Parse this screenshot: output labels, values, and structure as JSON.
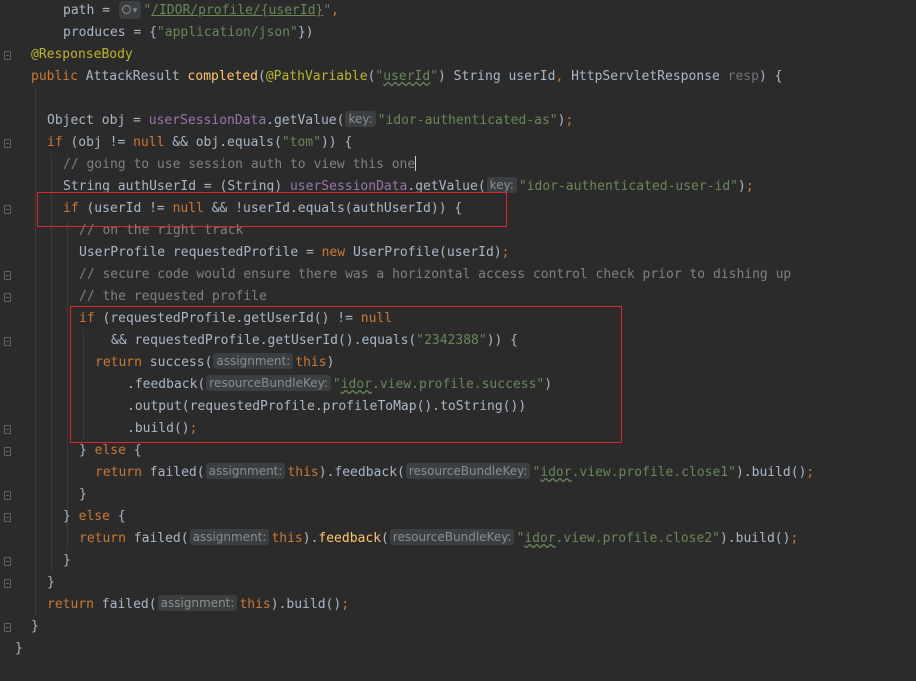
{
  "editor": {
    "lines": [
      {
        "indent": 63,
        "tokens": [
          {
            "c": "plain",
            "t": "path = "
          },
          {
            "c": "hint-globe",
            "t": ""
          },
          {
            "c": "str",
            "t": "\""
          },
          {
            "c": "str ul",
            "t": "/IDOR/profile/{userId}"
          },
          {
            "c": "str",
            "t": "\""
          },
          {
            "c": "kw",
            "t": ","
          }
        ]
      },
      {
        "indent": 63,
        "tokens": [
          {
            "c": "plain",
            "t": "produces = {"
          },
          {
            "c": "str",
            "t": "\"application/json\""
          },
          {
            "c": "plain",
            "t": "})"
          }
        ]
      },
      {
        "indent": 31,
        "tokens": [
          {
            "c": "ann",
            "t": "@ResponseBody"
          }
        ]
      },
      {
        "indent": 31,
        "tokens": [
          {
            "c": "kw",
            "t": "public "
          },
          {
            "c": "plain",
            "t": "AttackResult "
          },
          {
            "c": "fn",
            "t": "completed"
          },
          {
            "c": "plain",
            "t": "("
          },
          {
            "c": "ann",
            "t": "@PathVariable"
          },
          {
            "c": "plain",
            "t": "("
          },
          {
            "c": "str",
            "t": "\""
          },
          {
            "c": "str wavy",
            "t": "userId"
          },
          {
            "c": "str",
            "t": "\""
          },
          {
            "c": "plain",
            "t": ") String userId"
          },
          {
            "c": "kw",
            "t": ", "
          },
          {
            "c": "plain",
            "t": "HttpServletResponse "
          },
          {
            "c": "param",
            "t": "resp"
          },
          {
            "c": "plain",
            "t": ") {"
          }
        ]
      },
      {
        "indent": 47,
        "tokens": []
      },
      {
        "indent": 47,
        "tokens": [
          {
            "c": "plain",
            "t": "Object obj = "
          },
          {
            "c": "fld",
            "t": "userSessionData"
          },
          {
            "c": "plain",
            "t": ".getValue("
          },
          {
            "c": "hint",
            "t": "key:"
          },
          {
            "c": "str",
            "t": "\"idor-authenticated-as\""
          },
          {
            "c": "plain",
            "t": ")"
          },
          {
            "c": "kw",
            "t": ";"
          }
        ]
      },
      {
        "indent": 47,
        "tokens": [
          {
            "c": "kw",
            "t": "if "
          },
          {
            "c": "plain",
            "t": "(obj != "
          },
          {
            "c": "kw",
            "t": "null "
          },
          {
            "c": "plain",
            "t": "&& obj.equals("
          },
          {
            "c": "str",
            "t": "\"tom\""
          },
          {
            "c": "plain",
            "t": ")) {"
          }
        ]
      },
      {
        "indent": 63,
        "tokens": [
          {
            "c": "cmt",
            "t": "// going to use session auth to view this one"
          },
          {
            "c": "caret",
            "t": ""
          }
        ]
      },
      {
        "indent": 63,
        "tokens": [
          {
            "c": "plain",
            "t": "String authUserId = (String) "
          },
          {
            "c": "fld",
            "t": "userSessionData"
          },
          {
            "c": "plain",
            "t": ".getValue("
          },
          {
            "c": "hint",
            "t": "key:"
          },
          {
            "c": "str",
            "t": "\"idor-authenticated-user-id\""
          },
          {
            "c": "plain",
            "t": ")"
          },
          {
            "c": "kw",
            "t": ";"
          }
        ]
      },
      {
        "indent": 63,
        "tokens": [
          {
            "c": "kw",
            "t": "if "
          },
          {
            "c": "plain",
            "t": "(userId != "
          },
          {
            "c": "kw",
            "t": "null "
          },
          {
            "c": "plain",
            "t": "&& !userId.equals(authUserId)) {"
          }
        ]
      },
      {
        "indent": 79,
        "tokens": [
          {
            "c": "cmt",
            "t": "// on the right track"
          }
        ]
      },
      {
        "indent": 79,
        "tokens": [
          {
            "c": "plain",
            "t": "UserProfile requestedProfile = "
          },
          {
            "c": "kw",
            "t": "new "
          },
          {
            "c": "plain",
            "t": "UserProfile(userId)"
          },
          {
            "c": "kw",
            "t": ";"
          }
        ]
      },
      {
        "indent": 79,
        "tokens": [
          {
            "c": "cmt",
            "t": "// secure code would ensure there was a horizontal access control check prior to dishing up"
          }
        ]
      },
      {
        "indent": 79,
        "tokens": [
          {
            "c": "cmt",
            "t": "// the requested profile"
          }
        ]
      },
      {
        "indent": 79,
        "tokens": [
          {
            "c": "kw",
            "t": "if "
          },
          {
            "c": "plain",
            "t": "(requestedProfile.getUserId() != "
          },
          {
            "c": "kw",
            "t": "null"
          }
        ]
      },
      {
        "indent": 111,
        "tokens": [
          {
            "c": "plain",
            "t": "&& requestedProfile.getUserId().equals("
          },
          {
            "c": "str",
            "t": "\"2342388\""
          },
          {
            "c": "plain",
            "t": ")) {"
          }
        ]
      },
      {
        "indent": 95,
        "tokens": [
          {
            "c": "kw",
            "t": "return "
          },
          {
            "c": "plain",
            "t": "success("
          },
          {
            "c": "hint",
            "t": "assignment:"
          },
          {
            "c": "kw",
            "t": "this"
          },
          {
            "c": "plain",
            "t": ")"
          }
        ]
      },
      {
        "indent": 127,
        "tokens": [
          {
            "c": "plain",
            "t": ".feedback("
          },
          {
            "c": "hint",
            "t": "resourceBundleKey:"
          },
          {
            "c": "str",
            "t": "\""
          },
          {
            "c": "str wavy",
            "t": "idor"
          },
          {
            "c": "str",
            "t": ".view.profile.success\""
          },
          {
            "c": "plain",
            "t": ")"
          }
        ]
      },
      {
        "indent": 127,
        "tokens": [
          {
            "c": "plain",
            "t": ".output(requestedProfile.profileToMap().toString())"
          }
        ]
      },
      {
        "indent": 127,
        "tokens": [
          {
            "c": "plain",
            "t": ".build()"
          },
          {
            "c": "kw",
            "t": ";"
          }
        ]
      },
      {
        "indent": 79,
        "tokens": [
          {
            "c": "plain",
            "t": "} "
          },
          {
            "c": "kw",
            "t": "else "
          },
          {
            "c": "plain",
            "t": "{"
          }
        ]
      },
      {
        "indent": 95,
        "tokens": [
          {
            "c": "kw",
            "t": "return "
          },
          {
            "c": "plain",
            "t": "failed("
          },
          {
            "c": "hint",
            "t": "assignment:"
          },
          {
            "c": "kw",
            "t": "this"
          },
          {
            "c": "plain",
            "t": ").feedback("
          },
          {
            "c": "hint",
            "t": "resourceBundleKey:"
          },
          {
            "c": "str",
            "t": "\""
          },
          {
            "c": "str wavy",
            "t": "idor"
          },
          {
            "c": "str",
            "t": ".view.profile.close1\""
          },
          {
            "c": "plain",
            "t": ").build()"
          },
          {
            "c": "kw",
            "t": ";"
          }
        ]
      },
      {
        "indent": 79,
        "tokens": [
          {
            "c": "plain",
            "t": "}"
          }
        ]
      },
      {
        "indent": 63,
        "tokens": [
          {
            "c": "plain",
            "t": "} "
          },
          {
            "c": "kw",
            "t": "else "
          },
          {
            "c": "plain",
            "t": "{"
          }
        ]
      },
      {
        "indent": 79,
        "tokens": [
          {
            "c": "kw",
            "t": "return "
          },
          {
            "c": "plain",
            "t": "failed("
          },
          {
            "c": "hint",
            "t": "assignment:"
          },
          {
            "c": "kw",
            "t": "this"
          },
          {
            "c": "plain",
            "t": ")."
          },
          {
            "c": "fn-plain",
            "t": "feedback"
          },
          {
            "c": "plain",
            "t": "("
          },
          {
            "c": "hint",
            "t": "resourceBundleKey:"
          },
          {
            "c": "str",
            "t": "\""
          },
          {
            "c": "str wavy",
            "t": "idor"
          },
          {
            "c": "str",
            "t": ".view.profile.close2\""
          },
          {
            "c": "plain",
            "t": ").build()"
          },
          {
            "c": "kw",
            "t": ";"
          }
        ]
      },
      {
        "indent": 63,
        "tokens": [
          {
            "c": "plain",
            "t": "}"
          }
        ]
      },
      {
        "indent": 47,
        "tokens": [
          {
            "c": "plain",
            "t": "}"
          }
        ]
      },
      {
        "indent": 47,
        "tokens": [
          {
            "c": "kw",
            "t": "return "
          },
          {
            "c": "plain",
            "t": "failed("
          },
          {
            "c": "hint",
            "t": "assignment:"
          },
          {
            "c": "kw",
            "t": "this"
          },
          {
            "c": "plain",
            "t": ").build()"
          },
          {
            "c": "kw",
            "t": ";"
          }
        ]
      },
      {
        "indent": 31,
        "tokens": [
          {
            "c": "plain",
            "t": "}"
          }
        ]
      },
      {
        "indent": 15,
        "tokens": [
          {
            "c": "plain",
            "t": "}"
          }
        ]
      }
    ]
  },
  "highlights": [
    "if-condition-box",
    "profile-check-box"
  ],
  "colors": {
    "background": "#2b2b2b",
    "keyword": "#cc7832",
    "string": "#6a8759",
    "annotation": "#bbb529",
    "function": "#ffc66d",
    "field": "#9876aa",
    "comment": "#808080",
    "highlight_box": "#e0242b"
  }
}
